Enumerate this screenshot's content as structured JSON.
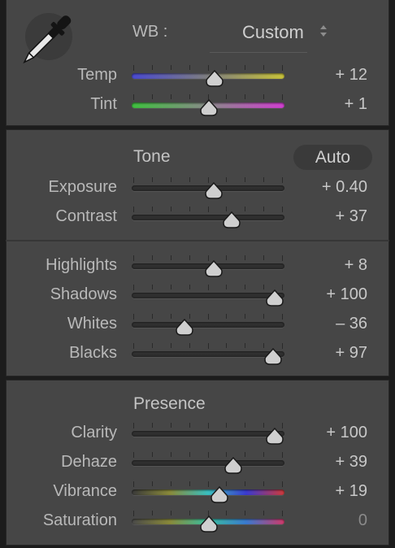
{
  "white_balance": {
    "label": "WB :",
    "selected": "Custom",
    "eyedropper_icon": "eyedropper-icon",
    "sliders": [
      {
        "id": "temp",
        "label": "Temp",
        "value": "+ 12",
        "position": 0.54,
        "track": "temp"
      },
      {
        "id": "tint",
        "label": "Tint",
        "value": "+ 1",
        "position": 0.505,
        "track": "tint"
      }
    ]
  },
  "tone": {
    "title": "Tone",
    "auto_label": "Auto",
    "sliders": [
      {
        "id": "exposure",
        "label": "Exposure",
        "value": "+ 0.40",
        "position": 0.535,
        "track": "gray"
      },
      {
        "id": "contrast",
        "label": "Contrast",
        "value": "+ 37",
        "position": 0.655,
        "track": "gray"
      }
    ],
    "sliders2": [
      {
        "id": "highlights",
        "label": "Highlights",
        "value": "+ 8",
        "position": 0.535,
        "track": "gray"
      },
      {
        "id": "shadows",
        "label": "Shadows",
        "value": "+ 100",
        "position": 0.935,
        "track": "gray"
      },
      {
        "id": "whites",
        "label": "Whites",
        "value": "– 36",
        "position": 0.345,
        "track": "gray"
      },
      {
        "id": "blacks",
        "label": "Blacks",
        "value": "+ 97",
        "position": 0.925,
        "track": "gray"
      }
    ]
  },
  "presence": {
    "title": "Presence",
    "sliders": [
      {
        "id": "clarity",
        "label": "Clarity",
        "value": "+ 100",
        "position": 0.935,
        "track": "gray"
      },
      {
        "id": "dehaze",
        "label": "Dehaze",
        "value": "+ 39",
        "position": 0.665,
        "track": "gray"
      },
      {
        "id": "vibrance",
        "label": "Vibrance",
        "value": "+ 19",
        "position": 0.575,
        "track": "vibrance"
      },
      {
        "id": "saturation",
        "label": "Saturation",
        "value": "0",
        "position": 0.505,
        "track": "saturation",
        "muted": true
      }
    ]
  },
  "colors": {
    "panel_bg": "#464646",
    "thumb": "#cfcfcf",
    "temp_track": [
      "#4a4ad0",
      "#7f7f7f",
      "#c9c33a"
    ],
    "tint_track": [
      "#3fc03f",
      "#8a8a8a",
      "#d13fd1"
    ],
    "vibrance_track": [
      "#3a3a3a",
      "#8a8a3a",
      "#3ac0c0",
      "#3a3ad0",
      "#d03a3a"
    ],
    "saturation_track": [
      "#4a4a4a",
      "#8a8a3a",
      "#3ac0a0",
      "#3a7ad0",
      "#d03a6a"
    ]
  }
}
